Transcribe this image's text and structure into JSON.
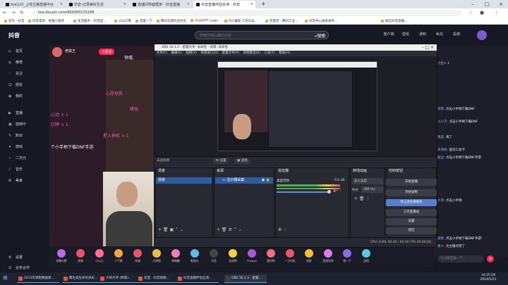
{
  "browser": {
    "tabs": [
      {
        "label": "live123_上线主播直播平台"
      },
      {
        "label": "抖音-记录美好生活"
      },
      {
        "label": "直播间界面框架 - 抖音直播"
      },
      {
        "label": "抖音直播伴侣丝滑 - 抖音"
      }
    ],
    "new_tab": "+",
    "url": "live.douyin.com/660093215268",
    "bookmarks": [
      "首页 - 抖音",
      "抖音电商 - 星推小程序",
      "生活服务 - 抖音团...",
      "火山引擎",
      "百度一下",
      "腾讯云我的主控台",
      "ChatGPT Login",
      "PLC编程 工控论坛...",
      "巨量百 - 腾讯工业...",
      "抖音中心版本发布...",
      "微信抖音直播..."
    ]
  },
  "douyin": {
    "logo": "抖音",
    "search_placeholder": "搜索你感兴趣的内容",
    "search_btn": "搜索",
    "header_icons": [
      "客户端",
      "壁纸",
      "通知",
      "私信",
      "投稿"
    ],
    "sidebar": [
      "首页",
      "推荐",
      "关注",
      "朋友",
      "我的",
      "直播",
      "放映厅",
      "知识",
      "游戏",
      "二次元",
      "音乐",
      "美食",
      "设置",
      "业务合作"
    ],
    "streamer": "老铁王",
    "follow": "+关注",
    "danmu": [
      "钟馗.",
      "心愿抢救",
      "蜡烛",
      "灯牌 × 1",
      "心动 × 1",
      "个小手柄下载DNF手游",
      "星入神机 × 1",
      "点击小手柄下载DNF手游"
    ],
    "gifts": [
      "龙鳞卡牌",
      "玫瑰",
      "小心心",
      "人气票",
      "玫瑰",
      "大啤酒",
      "棒棒糖",
      "能量水",
      "抖音",
      "加油鸭",
      "Thepbe",
      "爱你哟",
      "一万亿枝",
      "新星",
      "星星泡泡",
      "嗨一下",
      "游戏"
    ],
    "chat": [
      {
        "user": "小鱼",
        "text": "× 1"
      },
      {
        "user": "老铁",
        "text": ": 点击小手柄下载DNF"
      },
      {
        "user": "小小子",
        "text": ": 点击小手柄下载DNF"
      },
      {
        "user": "我是",
        "text": ": 来了"
      },
      {
        "user": "风清扬",
        "text": ": 金冠工会卡"
      },
      {
        "user": "粉丝",
        "text": ": 点击小手柄下载DNF手游"
      },
      {
        "user": "大哥",
        "text": ": 点击小手柄"
      },
      {
        "user": "游客",
        "text": ": 点击小手柄下载DNF手游!"
      },
      {
        "user": "路人",
        "text": ": 为主播点赞了"
      }
    ],
    "chat_placeholder": "与大家互动一下...",
    "chat_send": "➤"
  },
  "obs": {
    "title": "OBS 30.1.2 - 配置文件: 未命名 - 场景: 未命名",
    "menu": [
      "文件(F)",
      "编辑(E)",
      "视图(V)",
      "停靠窗口(D)",
      "配置文件(P)",
      "场景集合(S)",
      "工具(T)",
      "帮助(H)"
    ],
    "no_source": "未选择源",
    "toolbar": [
      "⚙ 设置",
      "▣ 滤镜"
    ],
    "docks": {
      "scenes": "场景",
      "sources": "来源",
      "mixer": "混音器",
      "transitions": "转场动画",
      "controls": "控制按钮"
    },
    "scene_item": "场景",
    "source_item": "显示器采集",
    "mixer_track": "桌面音频",
    "mixer_db": "0.0 dB",
    "transition_type": "淡入淡出",
    "duration_label": "时长",
    "duration": "300 ms",
    "controls": [
      "开始直播",
      "开始录制",
      "停止虚拟摄像机",
      "工作室模式",
      "设置",
      "退出"
    ],
    "status": "CPU: 0.8%    60.00 / 60.00 FPS    00:00:00"
  },
  "taskbar": {
    "start": "⊞",
    "items": [
      "2015年销售数据库...",
      "聚生美生命的多彩...",
      "大师点评 (原稿)...",
      "双亚 - 抖音视频...",
      "抖音直播伴侣丝滑...",
      "OBS 30.1.2 - 配置..."
    ],
    "time": "14:25:29",
    "date": "2024/5/21"
  }
}
